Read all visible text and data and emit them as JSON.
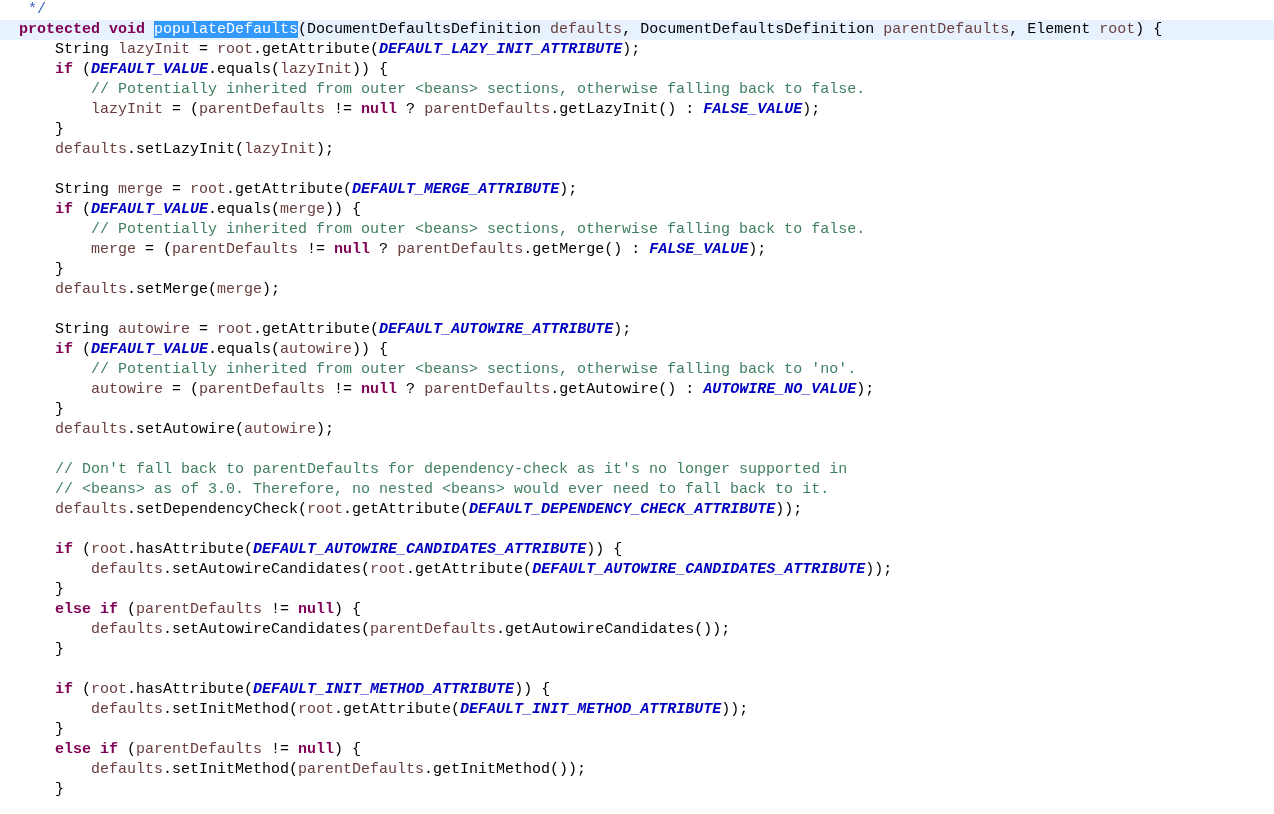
{
  "editor": {
    "blocks": [
      {
        "lines": [
          {
            "current": false,
            "tokens": [
              {
                "kind": "doc",
                "text": " */"
              }
            ]
          },
          {
            "current": true,
            "tokens": [
              {
                "kind": "keyword",
                "text": "protected void "
              },
              {
                "kind": "selected",
                "text": "populateDefaults"
              },
              {
                "kind": "plain",
                "text": "(DocumentDefaultsDefinition "
              },
              {
                "kind": "variable",
                "text": "defaults"
              },
              {
                "kind": "plain",
                "text": ", DocumentDefaultsDefinition "
              },
              {
                "kind": "variable",
                "text": "parentDefaults"
              },
              {
                "kind": "plain",
                "text": ", Element "
              },
              {
                "kind": "variable",
                "text": "root"
              },
              {
                "kind": "plain",
                "text": ") {"
              }
            ]
          },
          {
            "current": false,
            "tokens": [
              {
                "kind": "plain",
                "text": "    String "
              },
              {
                "kind": "variable",
                "text": "lazyInit"
              },
              {
                "kind": "plain",
                "text": " = "
              },
              {
                "kind": "variable",
                "text": "root"
              },
              {
                "kind": "plain",
                "text": ".getAttribute("
              },
              {
                "kind": "constant",
                "text": "DEFAULT_LAZY_INIT_ATTRIBUTE"
              },
              {
                "kind": "plain",
                "text": ");"
              }
            ]
          },
          {
            "current": false,
            "tokens": [
              {
                "kind": "keyword",
                "text": "    if"
              },
              {
                "kind": "plain",
                "text": " ("
              },
              {
                "kind": "constant",
                "text": "DEFAULT_VALUE"
              },
              {
                "kind": "plain",
                "text": ".equals("
              },
              {
                "kind": "variable",
                "text": "lazyInit"
              },
              {
                "kind": "plain",
                "text": ")) {"
              }
            ]
          },
          {
            "current": false,
            "tokens": [
              {
                "kind": "comment",
                "text": "        // Potentially inherited from outer <beans> sections, otherwise falling back to false."
              }
            ]
          },
          {
            "current": false,
            "tokens": [
              {
                "kind": "variable",
                "text": "        lazyInit"
              },
              {
                "kind": "plain",
                "text": " = ("
              },
              {
                "kind": "variable",
                "text": "parentDefaults"
              },
              {
                "kind": "plain",
                "text": " != "
              },
              {
                "kind": "keyword",
                "text": "null"
              },
              {
                "kind": "plain",
                "text": " ? "
              },
              {
                "kind": "variable",
                "text": "parentDefaults"
              },
              {
                "kind": "plain",
                "text": ".getLazyInit() : "
              },
              {
                "kind": "constant",
                "text": "FALSE_VALUE"
              },
              {
                "kind": "plain",
                "text": ");"
              }
            ]
          },
          {
            "current": false,
            "tokens": [
              {
                "kind": "plain",
                "text": "    }"
              }
            ]
          },
          {
            "current": false,
            "tokens": [
              {
                "kind": "variable",
                "text": "    defaults"
              },
              {
                "kind": "plain",
                "text": ".setLazyInit("
              },
              {
                "kind": "variable",
                "text": "lazyInit"
              },
              {
                "kind": "plain",
                "text": ");"
              }
            ]
          }
        ]
      },
      {
        "lines": [
          {
            "current": false,
            "tokens": [
              {
                "kind": "plain",
                "text": "    String "
              },
              {
                "kind": "variable",
                "text": "merge"
              },
              {
                "kind": "plain",
                "text": " = "
              },
              {
                "kind": "variable",
                "text": "root"
              },
              {
                "kind": "plain",
                "text": ".getAttribute("
              },
              {
                "kind": "constant",
                "text": "DEFAULT_MERGE_ATTRIBUTE"
              },
              {
                "kind": "plain",
                "text": ");"
              }
            ]
          },
          {
            "current": false,
            "tokens": [
              {
                "kind": "keyword",
                "text": "    if"
              },
              {
                "kind": "plain",
                "text": " ("
              },
              {
                "kind": "constant",
                "text": "DEFAULT_VALUE"
              },
              {
                "kind": "plain",
                "text": ".equals("
              },
              {
                "kind": "variable",
                "text": "merge"
              },
              {
                "kind": "plain",
                "text": ")) {"
              }
            ]
          },
          {
            "current": false,
            "tokens": [
              {
                "kind": "comment",
                "text": "        // Potentially inherited from outer <beans> sections, otherwise falling back to false."
              }
            ]
          },
          {
            "current": false,
            "tokens": [
              {
                "kind": "variable",
                "text": "        merge"
              },
              {
                "kind": "plain",
                "text": " = ("
              },
              {
                "kind": "variable",
                "text": "parentDefaults"
              },
              {
                "kind": "plain",
                "text": " != "
              },
              {
                "kind": "keyword",
                "text": "null"
              },
              {
                "kind": "plain",
                "text": " ? "
              },
              {
                "kind": "variable",
                "text": "parentDefaults"
              },
              {
                "kind": "plain",
                "text": ".getMerge() : "
              },
              {
                "kind": "constant",
                "text": "FALSE_VALUE"
              },
              {
                "kind": "plain",
                "text": ");"
              }
            ]
          },
          {
            "current": false,
            "tokens": [
              {
                "kind": "plain",
                "text": "    }"
              }
            ]
          },
          {
            "current": false,
            "tokens": [
              {
                "kind": "variable",
                "text": "    defaults"
              },
              {
                "kind": "plain",
                "text": ".setMerge("
              },
              {
                "kind": "variable",
                "text": "merge"
              },
              {
                "kind": "plain",
                "text": ");"
              }
            ]
          }
        ]
      },
      {
        "lines": [
          {
            "current": false,
            "tokens": [
              {
                "kind": "plain",
                "text": "    String "
              },
              {
                "kind": "variable",
                "text": "autowire"
              },
              {
                "kind": "plain",
                "text": " = "
              },
              {
                "kind": "variable",
                "text": "root"
              },
              {
                "kind": "plain",
                "text": ".getAttribute("
              },
              {
                "kind": "constant",
                "text": "DEFAULT_AUTOWIRE_ATTRIBUTE"
              },
              {
                "kind": "plain",
                "text": ");"
              }
            ]
          },
          {
            "current": false,
            "tokens": [
              {
                "kind": "keyword",
                "text": "    if"
              },
              {
                "kind": "plain",
                "text": " ("
              },
              {
                "kind": "constant",
                "text": "DEFAULT_VALUE"
              },
              {
                "kind": "plain",
                "text": ".equals("
              },
              {
                "kind": "variable",
                "text": "autowire"
              },
              {
                "kind": "plain",
                "text": ")) {"
              }
            ]
          },
          {
            "current": false,
            "tokens": [
              {
                "kind": "comment",
                "text": "        // Potentially inherited from outer <beans> sections, otherwise falling back to 'no'."
              }
            ]
          },
          {
            "current": false,
            "tokens": [
              {
                "kind": "variable",
                "text": "        autowire"
              },
              {
                "kind": "plain",
                "text": " = ("
              },
              {
                "kind": "variable",
                "text": "parentDefaults"
              },
              {
                "kind": "plain",
                "text": " != "
              },
              {
                "kind": "keyword",
                "text": "null"
              },
              {
                "kind": "plain",
                "text": " ? "
              },
              {
                "kind": "variable",
                "text": "parentDefaults"
              },
              {
                "kind": "plain",
                "text": ".getAutowire() : "
              },
              {
                "kind": "constant",
                "text": "AUTOWIRE_NO_VALUE"
              },
              {
                "kind": "plain",
                "text": ");"
              }
            ]
          },
          {
            "current": false,
            "tokens": [
              {
                "kind": "plain",
                "text": "    }"
              }
            ]
          },
          {
            "current": false,
            "tokens": [
              {
                "kind": "variable",
                "text": "    defaults"
              },
              {
                "kind": "plain",
                "text": ".setAutowire("
              },
              {
                "kind": "variable",
                "text": "autowire"
              },
              {
                "kind": "plain",
                "text": ");"
              }
            ]
          }
        ]
      },
      {
        "lines": [
          {
            "current": false,
            "tokens": [
              {
                "kind": "comment",
                "text": "    // Don't fall back to parentDefaults for dependency-check as it's no longer supported in"
              }
            ]
          },
          {
            "current": false,
            "tokens": [
              {
                "kind": "comment",
                "text": "    // <beans> as of 3.0. Therefore, no nested <beans> would ever need to fall back to it."
              }
            ]
          },
          {
            "current": false,
            "tokens": [
              {
                "kind": "variable",
                "text": "    defaults"
              },
              {
                "kind": "plain",
                "text": ".setDependencyCheck("
              },
              {
                "kind": "variable",
                "text": "root"
              },
              {
                "kind": "plain",
                "text": ".getAttribute("
              },
              {
                "kind": "constant",
                "text": "DEFAULT_DEPENDENCY_CHECK_ATTRIBUTE"
              },
              {
                "kind": "plain",
                "text": "));"
              }
            ]
          }
        ]
      },
      {
        "lines": [
          {
            "current": false,
            "tokens": [
              {
                "kind": "keyword",
                "text": "    if"
              },
              {
                "kind": "plain",
                "text": " ("
              },
              {
                "kind": "variable",
                "text": "root"
              },
              {
                "kind": "plain",
                "text": ".hasAttribute("
              },
              {
                "kind": "constant",
                "text": "DEFAULT_AUTOWIRE_CANDIDATES_ATTRIBUTE"
              },
              {
                "kind": "plain",
                "text": ")) {"
              }
            ]
          },
          {
            "current": false,
            "tokens": [
              {
                "kind": "variable",
                "text": "        defaults"
              },
              {
                "kind": "plain",
                "text": ".setAutowireCandidates("
              },
              {
                "kind": "variable",
                "text": "root"
              },
              {
                "kind": "plain",
                "text": ".getAttribute("
              },
              {
                "kind": "constant",
                "text": "DEFAULT_AUTOWIRE_CANDIDATES_ATTRIBUTE"
              },
              {
                "kind": "plain",
                "text": "));"
              }
            ]
          },
          {
            "current": false,
            "tokens": [
              {
                "kind": "plain",
                "text": "    }"
              }
            ]
          },
          {
            "current": false,
            "tokens": [
              {
                "kind": "keyword",
                "text": "    else if"
              },
              {
                "kind": "plain",
                "text": " ("
              },
              {
                "kind": "variable",
                "text": "parentDefaults"
              },
              {
                "kind": "plain",
                "text": " != "
              },
              {
                "kind": "keyword",
                "text": "null"
              },
              {
                "kind": "plain",
                "text": ") {"
              }
            ]
          },
          {
            "current": false,
            "tokens": [
              {
                "kind": "variable",
                "text": "        defaults"
              },
              {
                "kind": "plain",
                "text": ".setAutowireCandidates("
              },
              {
                "kind": "variable",
                "text": "parentDefaults"
              },
              {
                "kind": "plain",
                "text": ".getAutowireCandidates());"
              }
            ]
          },
          {
            "current": false,
            "tokens": [
              {
                "kind": "plain",
                "text": "    }"
              }
            ]
          }
        ]
      },
      {
        "lines": [
          {
            "current": false,
            "tokens": [
              {
                "kind": "keyword",
                "text": "    if"
              },
              {
                "kind": "plain",
                "text": " ("
              },
              {
                "kind": "variable",
                "text": "root"
              },
              {
                "kind": "plain",
                "text": ".hasAttribute("
              },
              {
                "kind": "constant",
                "text": "DEFAULT_INIT_METHOD_ATTRIBUTE"
              },
              {
                "kind": "plain",
                "text": ")) {"
              }
            ]
          },
          {
            "current": false,
            "tokens": [
              {
                "kind": "variable",
                "text": "        defaults"
              },
              {
                "kind": "plain",
                "text": ".setInitMethod("
              },
              {
                "kind": "variable",
                "text": "root"
              },
              {
                "kind": "plain",
                "text": ".getAttribute("
              },
              {
                "kind": "constant",
                "text": "DEFAULT_INIT_METHOD_ATTRIBUTE"
              },
              {
                "kind": "plain",
                "text": "));"
              }
            ]
          },
          {
            "current": false,
            "tokens": [
              {
                "kind": "plain",
                "text": "    }"
              }
            ]
          },
          {
            "current": false,
            "tokens": [
              {
                "kind": "keyword",
                "text": "    else if"
              },
              {
                "kind": "plain",
                "text": " ("
              },
              {
                "kind": "variable",
                "text": "parentDefaults"
              },
              {
                "kind": "plain",
                "text": " != "
              },
              {
                "kind": "keyword",
                "text": "null"
              },
              {
                "kind": "plain",
                "text": ") {"
              }
            ]
          },
          {
            "current": false,
            "tokens": [
              {
                "kind": "variable",
                "text": "        defaults"
              },
              {
                "kind": "plain",
                "text": ".setInitMethod("
              },
              {
                "kind": "variable",
                "text": "parentDefaults"
              },
              {
                "kind": "plain",
                "text": ".getInitMethod());"
              }
            ]
          },
          {
            "current": false,
            "tokens": [
              {
                "kind": "plain",
                "text": "    }"
              }
            ]
          }
        ]
      }
    ]
  }
}
